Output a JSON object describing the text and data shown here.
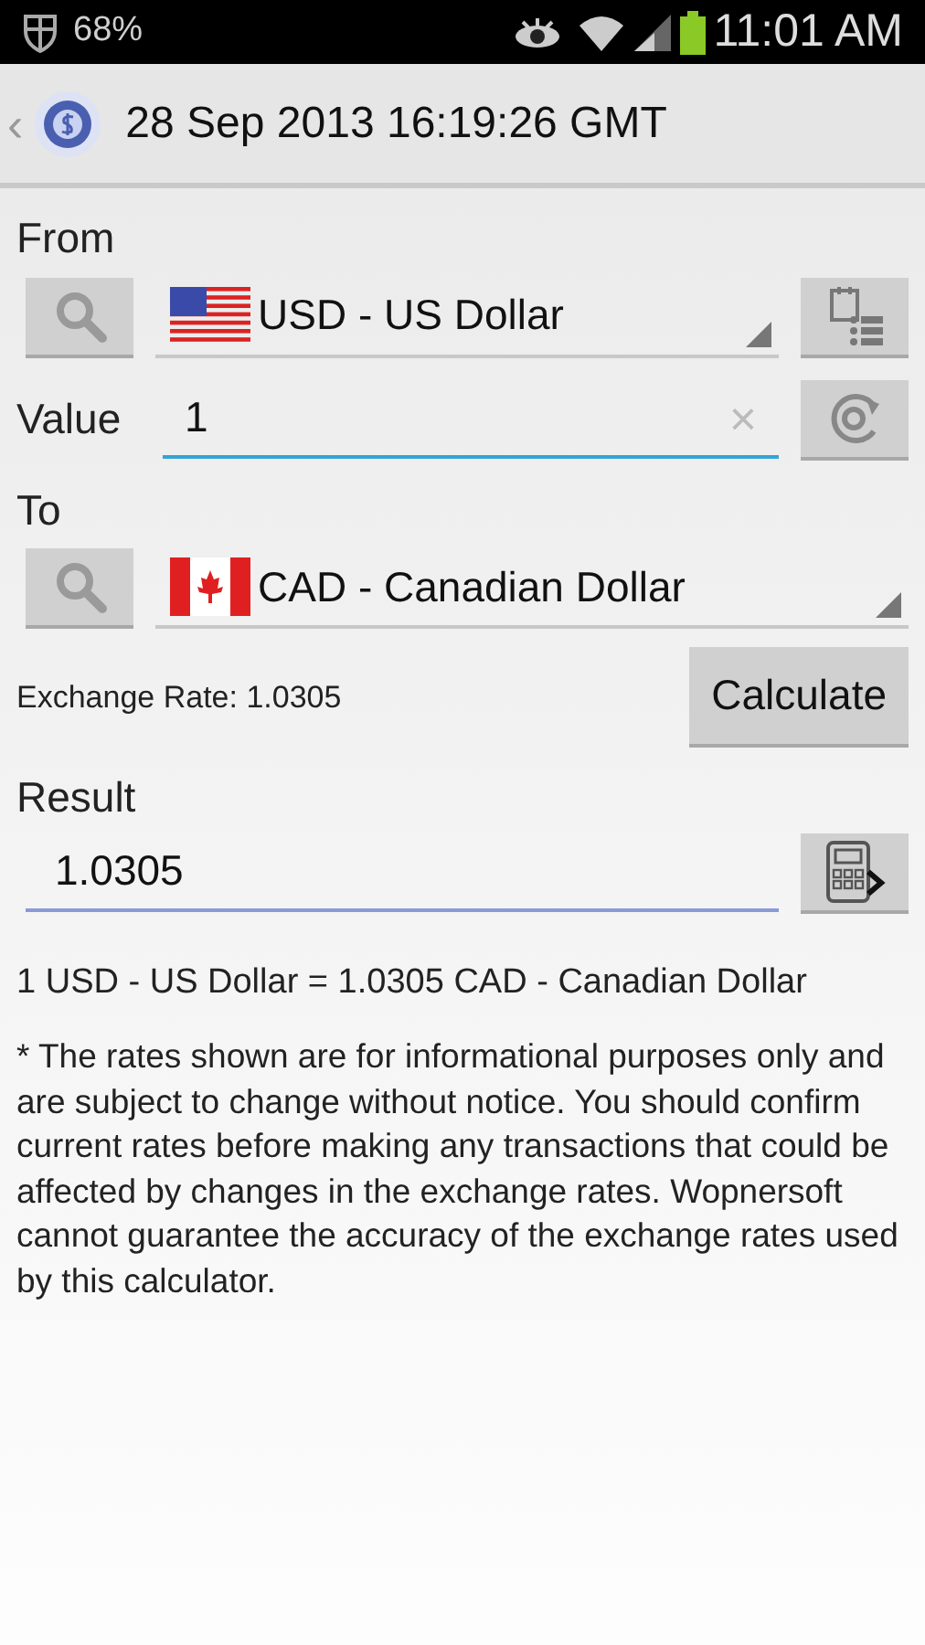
{
  "status_bar": {
    "battery_percent": "68%",
    "time": "11:01 AM"
  },
  "action_bar": {
    "back": "‹",
    "title": "28 Sep 2013 16:19:26 GMT"
  },
  "from": {
    "label": "From",
    "currency": "USD - US Dollar",
    "flag": {
      "kind": "us"
    }
  },
  "value": {
    "label": "Value",
    "value": "1",
    "clear": "×"
  },
  "to": {
    "label": "To",
    "currency": "CAD - Canadian Dollar",
    "flag": {
      "kind": "ca"
    }
  },
  "exchange_rate": "Exchange Rate: 1.0305",
  "calculate_button": "Calculate",
  "result": {
    "label": "Result",
    "value": "1.0305"
  },
  "summary": "1 USD - US Dollar = 1.0305 CAD - Canadian Dollar",
  "disclaimer": "* The rates shown are for informational purposes only and are subject to change without notice. You should confirm current rates before making any transactions that could be affected by changes in the exchange rates. Wopnersoft cannot guarantee the accuracy of the exchange rates used by this calculator."
}
